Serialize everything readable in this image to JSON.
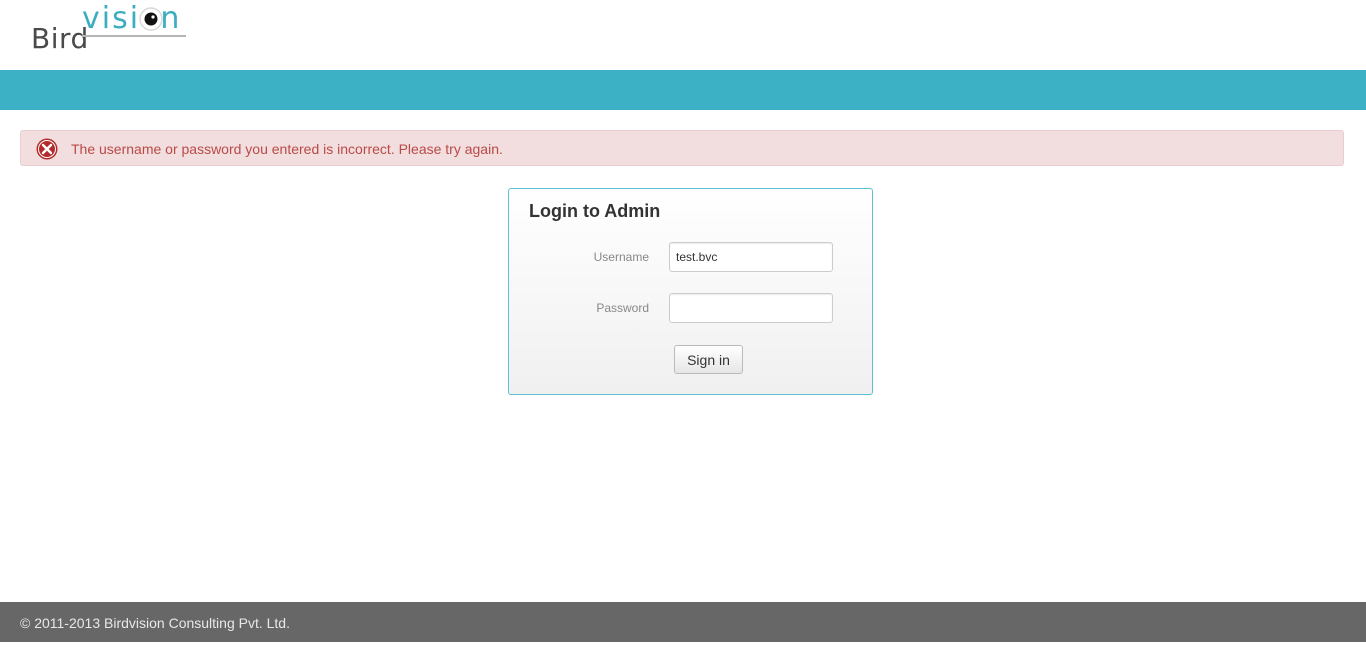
{
  "header": {
    "logo": {
      "word_bird": "Bird",
      "word_vision": "vision"
    }
  },
  "alert": {
    "icon": "error-circle-x-icon",
    "message": "The username or password you entered is incorrect. Please try again."
  },
  "login": {
    "title": "Login to Admin",
    "username_label": "Username",
    "username_value": "test.bvc",
    "password_label": "Password",
    "password_value": "",
    "signin_label": "Sign in"
  },
  "footer": {
    "copyright": "© 2011-2013 Birdvision Consulting Pvt. Ltd."
  },
  "colors": {
    "brand_teal": "#3cb0c4",
    "alert_bg": "#f2dede",
    "alert_text": "#b94a48",
    "footer_bg": "#676767"
  }
}
